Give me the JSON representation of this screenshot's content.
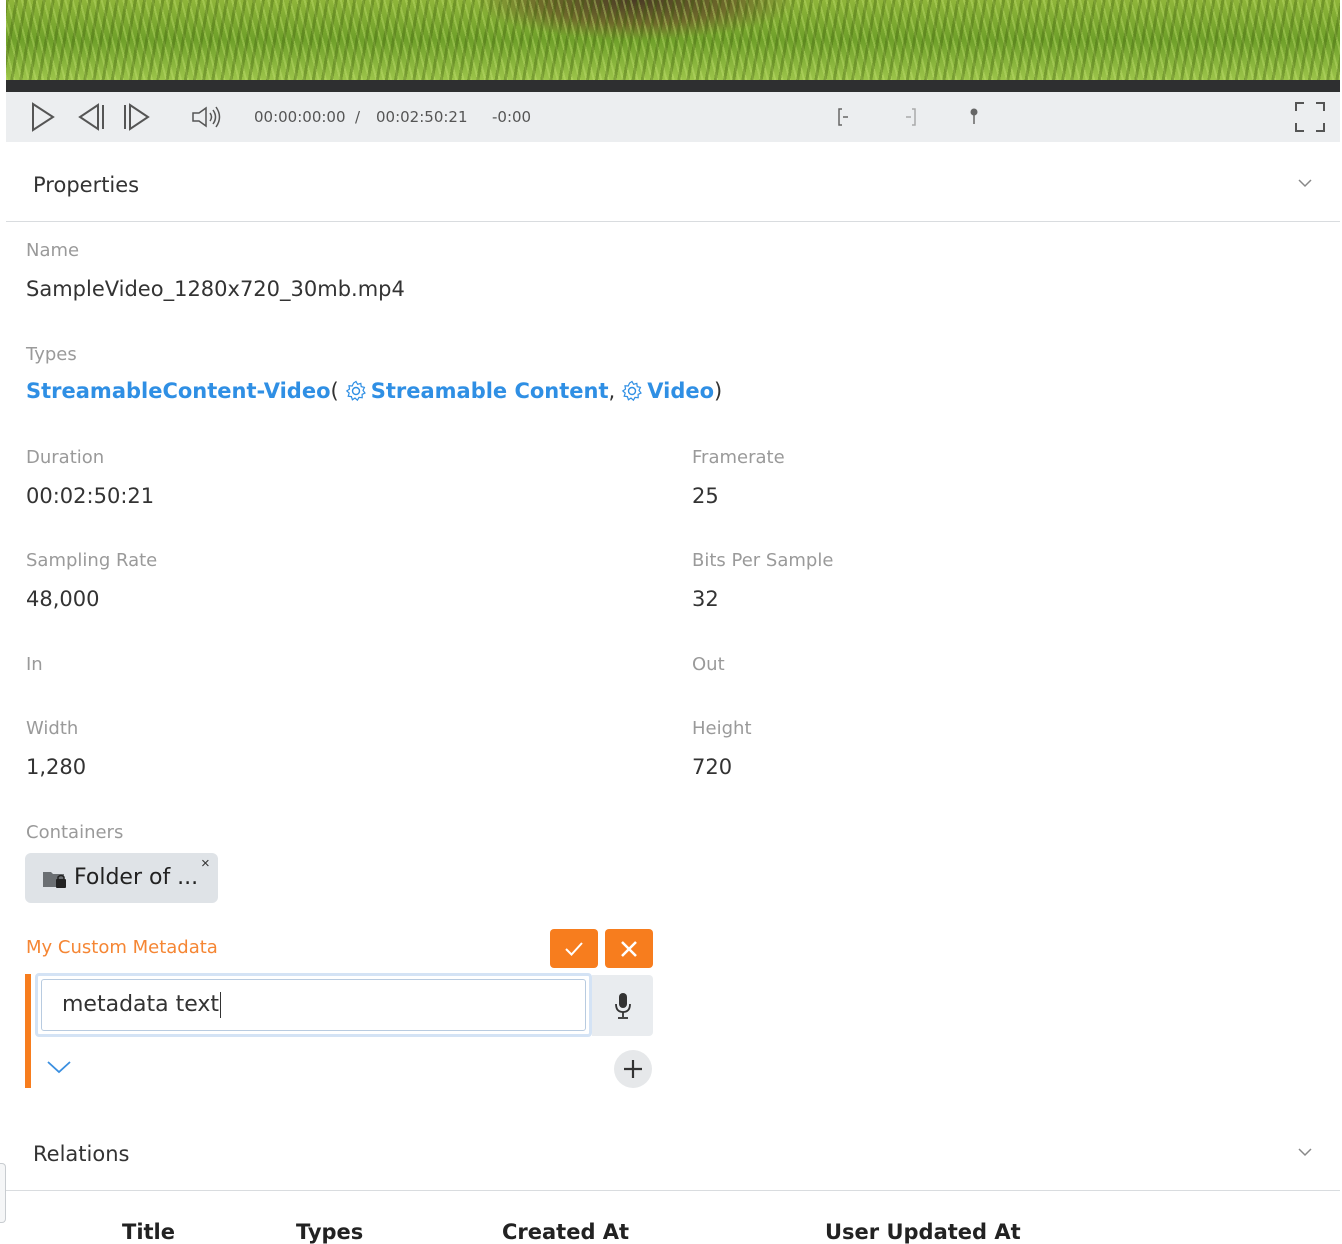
{
  "player": {
    "current_time": "00:00:00:00",
    "separator": "/",
    "total_time": "00:02:50:21",
    "remaining_time": "-0:00",
    "icons": [
      "play-icon",
      "step-back-icon",
      "step-forward-icon",
      "volume-icon",
      "mark-in-icon",
      "mark-out-icon",
      "marker-icon",
      "fullscreen-icon"
    ]
  },
  "properties": {
    "title": "Properties",
    "name_label": "Name",
    "name_value": "SampleVideo_1280x720_30mb.mp4",
    "types_label": "Types",
    "types_main": "StreamableContent-Video",
    "types_open": "(",
    "types_a": "Streamable Content",
    "types_comma": ",",
    "types_b": "Video",
    "types_close": ")",
    "duration_label": "Duration",
    "duration_value": "00:02:50:21",
    "framerate_label": "Framerate",
    "framerate_value": "25",
    "sampling_label": "Sampling Rate",
    "sampling_value": "48,000",
    "bits_label": "Bits Per Sample",
    "bits_value": "32",
    "in_label": "In",
    "out_label": "Out",
    "width_label": "Width",
    "width_value": "1,280",
    "height_label": "Height",
    "height_value": "720",
    "containers_label": "Containers",
    "container_chip": "Folder of ...",
    "chip_remove": "×",
    "custom_label": "My Custom Metadata",
    "custom_value": "metadata text"
  },
  "relations": {
    "title": "Relations",
    "columns": [
      "Title",
      "Types",
      "Created At",
      "User Updated At"
    ]
  },
  "colors": {
    "accent_orange": "#f77d1e",
    "link_blue": "#2f8fe4"
  }
}
